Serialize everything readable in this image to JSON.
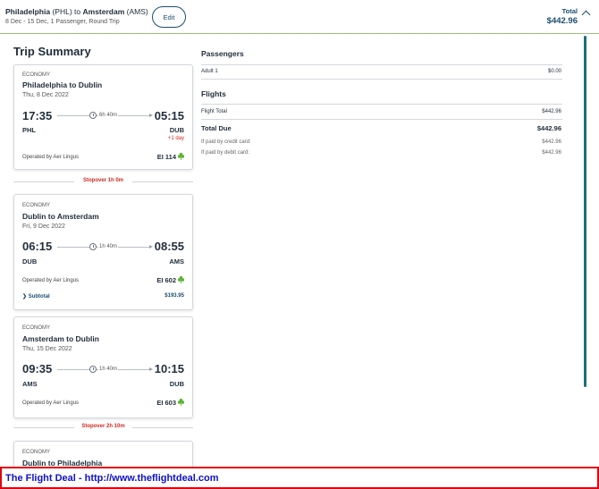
{
  "header": {
    "origin_city": "Philadelphia",
    "origin_code": "(PHL)",
    "to_word": "to",
    "dest_city": "Amsterdam",
    "dest_code": "(AMS)",
    "subtitle": "8 Dec - 15 Dec, 1 Passenger, Round Trip",
    "edit_label": "Edit",
    "total_label": "Total",
    "total_amount": "$442.96"
  },
  "trip_summary": {
    "title": "Trip Summary",
    "flights": [
      {
        "cabin": "ECONOMY",
        "route": "Philadelphia to Dublin",
        "date": "Thu, 8 Dec 2022",
        "dep_time": "17:35",
        "arr_time": "05:15",
        "duration": "6h 40m",
        "dep_code": "PHL",
        "arr_code": "DUB",
        "plus_day": "+1 day",
        "operated": "Operated by Aer Lingus",
        "flight_no": "EI 114"
      },
      {
        "cabin": "ECONOMY",
        "route": "Dublin to Amsterdam",
        "date": "Fri, 9 Dec 2022",
        "dep_time": "06:15",
        "arr_time": "08:55",
        "duration": "1h 40m",
        "dep_code": "DUB",
        "arr_code": "AMS",
        "operated": "Operated by Aer Lingus",
        "flight_no": "EI 602",
        "subtotal_label": "Subtotal",
        "subtotal_amount": "$193.95"
      },
      {
        "cabin": "ECONOMY",
        "route": "Amsterdam to Dublin",
        "date": "Thu, 15 Dec 2022",
        "dep_time": "09:35",
        "arr_time": "10:15",
        "duration": "1h 40m",
        "dep_code": "AMS",
        "arr_code": "DUB",
        "operated": "Operated by Aer Lingus",
        "flight_no": "EI 603"
      },
      {
        "cabin": "ECONOMY",
        "route": "Dublin to Philadelphia"
      }
    ],
    "stopovers": [
      "Stopover 1h 0m",
      "Stopover 2h 10m"
    ]
  },
  "summary": {
    "passengers_title": "Passengers",
    "adult_label": "Adult 1",
    "adult_value": "$0.00",
    "flights_title": "Flights",
    "flight_total_label": "Flight Total",
    "flight_total_value": "$442.96",
    "total_due_label": "Total Due",
    "total_due_value": "$442.96",
    "credit_label": "If paid by credit card:",
    "credit_value": "$442.96",
    "debit_label": "If paid by debit card:",
    "debit_value": "$442.96"
  },
  "banner": {
    "text": "The Flight Deal - http://www.theflightdeal.com"
  },
  "colors": {
    "brand_navy": "#1b4e6e",
    "accent_green": "#9ec27a",
    "alert_red": "#d0291f",
    "shamrock_green": "#5fb435",
    "banner_border": "#e0000f",
    "banner_text": "#1010c8"
  },
  "icons": {
    "edit": "none",
    "total_toggle": "chevron-up-icon",
    "duration": "clock-icon",
    "airline": "shamrock-icon",
    "subtotal_toggle": "chevron-right-icon"
  }
}
